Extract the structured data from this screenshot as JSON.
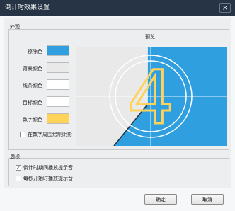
{
  "window": {
    "title": "倒计时效果设置",
    "close_symbol": "×"
  },
  "appearance": {
    "group_label": "外观",
    "preview_label": "预览",
    "colors": [
      {
        "label": "擦除色",
        "hex": "#2f9fe0"
      },
      {
        "label": "背景颜色",
        "hex": "#e9e9e9"
      },
      {
        "label": "线条颜色",
        "hex": "#ffffff"
      },
      {
        "label": "目标颜色",
        "hex": "#ffffff"
      },
      {
        "label": "数字颜色",
        "hex": "#ffd35a"
      }
    ],
    "shade_checkbox": {
      "label": "在数字周围绘制阴影",
      "checked": false
    }
  },
  "preview": {
    "digit": "4"
  },
  "options": {
    "group_label": "选项",
    "checkboxes": [
      {
        "label": "倒计时期间播放提示音",
        "checked": true
      },
      {
        "label": "每秒开始时播放提示音",
        "checked": false
      }
    ]
  },
  "buttons": {
    "ok": "确定",
    "cancel": "取消"
  }
}
